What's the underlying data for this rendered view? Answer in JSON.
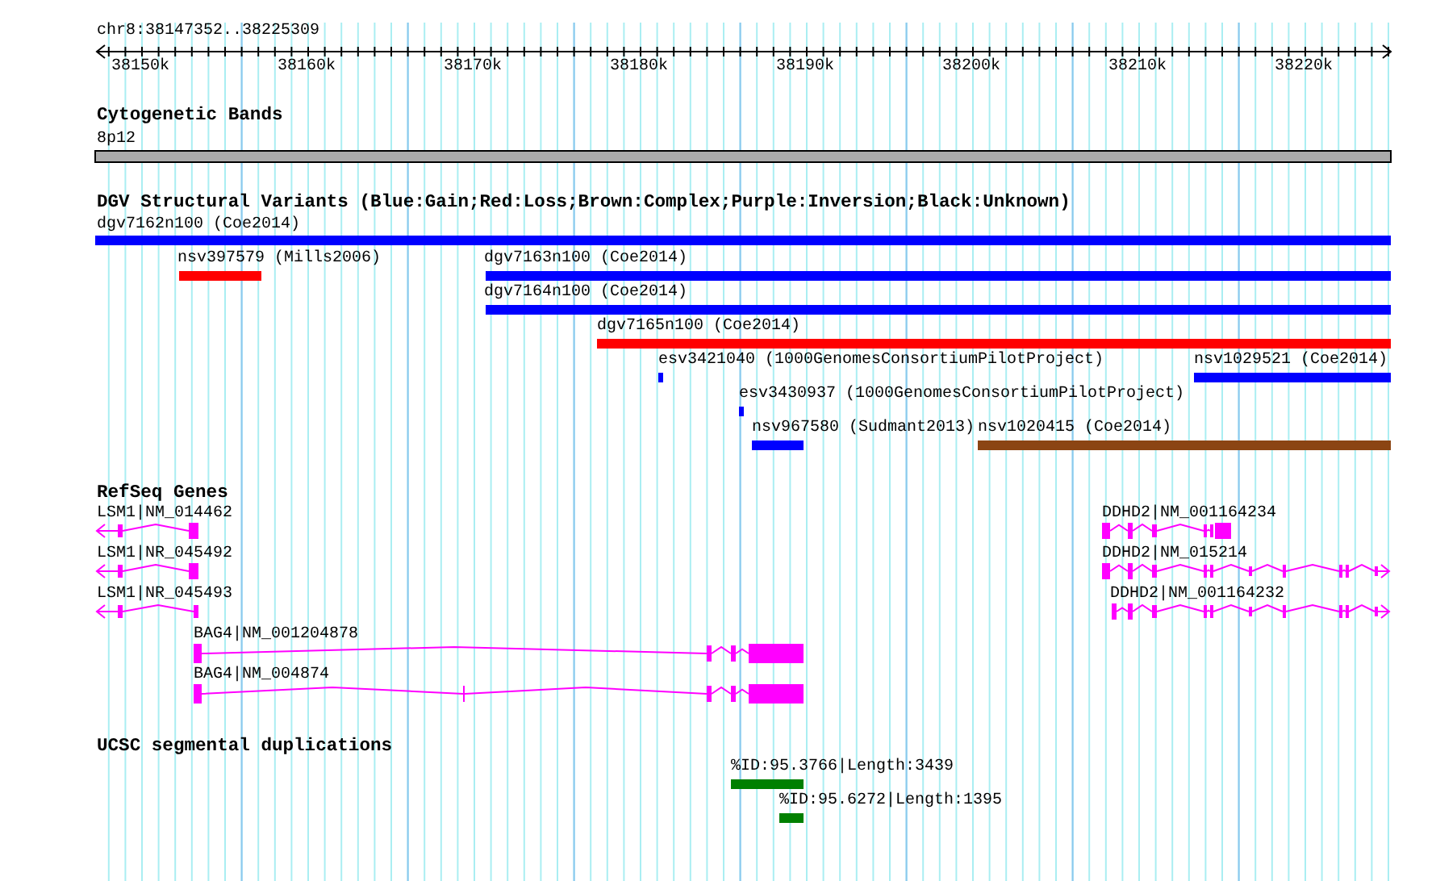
{
  "location": "chr8:38147352..38225309",
  "scale": {
    "labels": [
      "38150k",
      "38160k",
      "38170k",
      "38180k",
      "38190k",
      "38200k",
      "38210k",
      "38220k"
    ]
  },
  "cytogenetic_bands": {
    "title": "Cytogenetic Bands",
    "band": "8p12"
  },
  "structural_variants": {
    "title": "DGV Structural Variants (Blue:Gain;Red:Loss;Brown:Complex;Purple:Inversion;Black:Unknown)",
    "features": [
      {
        "label": "dgv7162n100 (Coe2014)",
        "color": "#0000ff"
      },
      {
        "label": "nsv397579 (Mills2006)",
        "color": "#ff0000"
      },
      {
        "label": "dgv7163n100 (Coe2014)",
        "color": "#0000ff"
      },
      {
        "label": "dgv7164n100 (Coe2014)",
        "color": "#0000ff"
      },
      {
        "label": "dgv7165n100 (Coe2014)",
        "color": "#ff0000"
      },
      {
        "label": "esv3421040 (1000GenomesConsortiumPilotProject)",
        "color": "#0000ff"
      },
      {
        "label": "nsv1029521 (Coe2014)",
        "color": "#0000ff"
      },
      {
        "label": "esv3430937 (1000GenomesConsortiumPilotProject)",
        "color": "#0000ff"
      },
      {
        "label": "nsv967580 (Sudmant2013)",
        "color": "#0000ff"
      },
      {
        "label": "nsv1020415 (Coe2014)",
        "color": "#8b4513"
      }
    ]
  },
  "refseq_genes": {
    "title": "RefSeq Genes",
    "genes": [
      {
        "label": "LSM1|NM_014462",
        "reverse_arrow": true,
        "forward_arrow": false
      },
      {
        "label": "LSM1|NR_045492",
        "reverse_arrow": true,
        "forward_arrow": false
      },
      {
        "label": "LSM1|NR_045493",
        "reverse_arrow": true,
        "forward_arrow": false
      },
      {
        "label": "DDHD2|NM_001164234",
        "reverse_arrow": false,
        "forward_arrow": false
      },
      {
        "label": "DDHD2|NM_015214",
        "reverse_arrow": false,
        "forward_arrow": true
      },
      {
        "label": "DDHD2|NM_001164232",
        "reverse_arrow": false,
        "forward_arrow": true
      },
      {
        "label": "BAG4|NM_001204878",
        "reverse_arrow": false,
        "forward_arrow": false
      },
      {
        "label": "BAG4|NM_004874",
        "reverse_arrow": false,
        "forward_arrow": false
      }
    ]
  },
  "segmental_duplications": {
    "title": "UCSC segmental duplications",
    "features": [
      {
        "label": "%ID:95.3766|Length:3439",
        "color": "#008000"
      },
      {
        "label": "%ID:95.6272|Length:1395",
        "color": "#008000"
      }
    ]
  }
}
